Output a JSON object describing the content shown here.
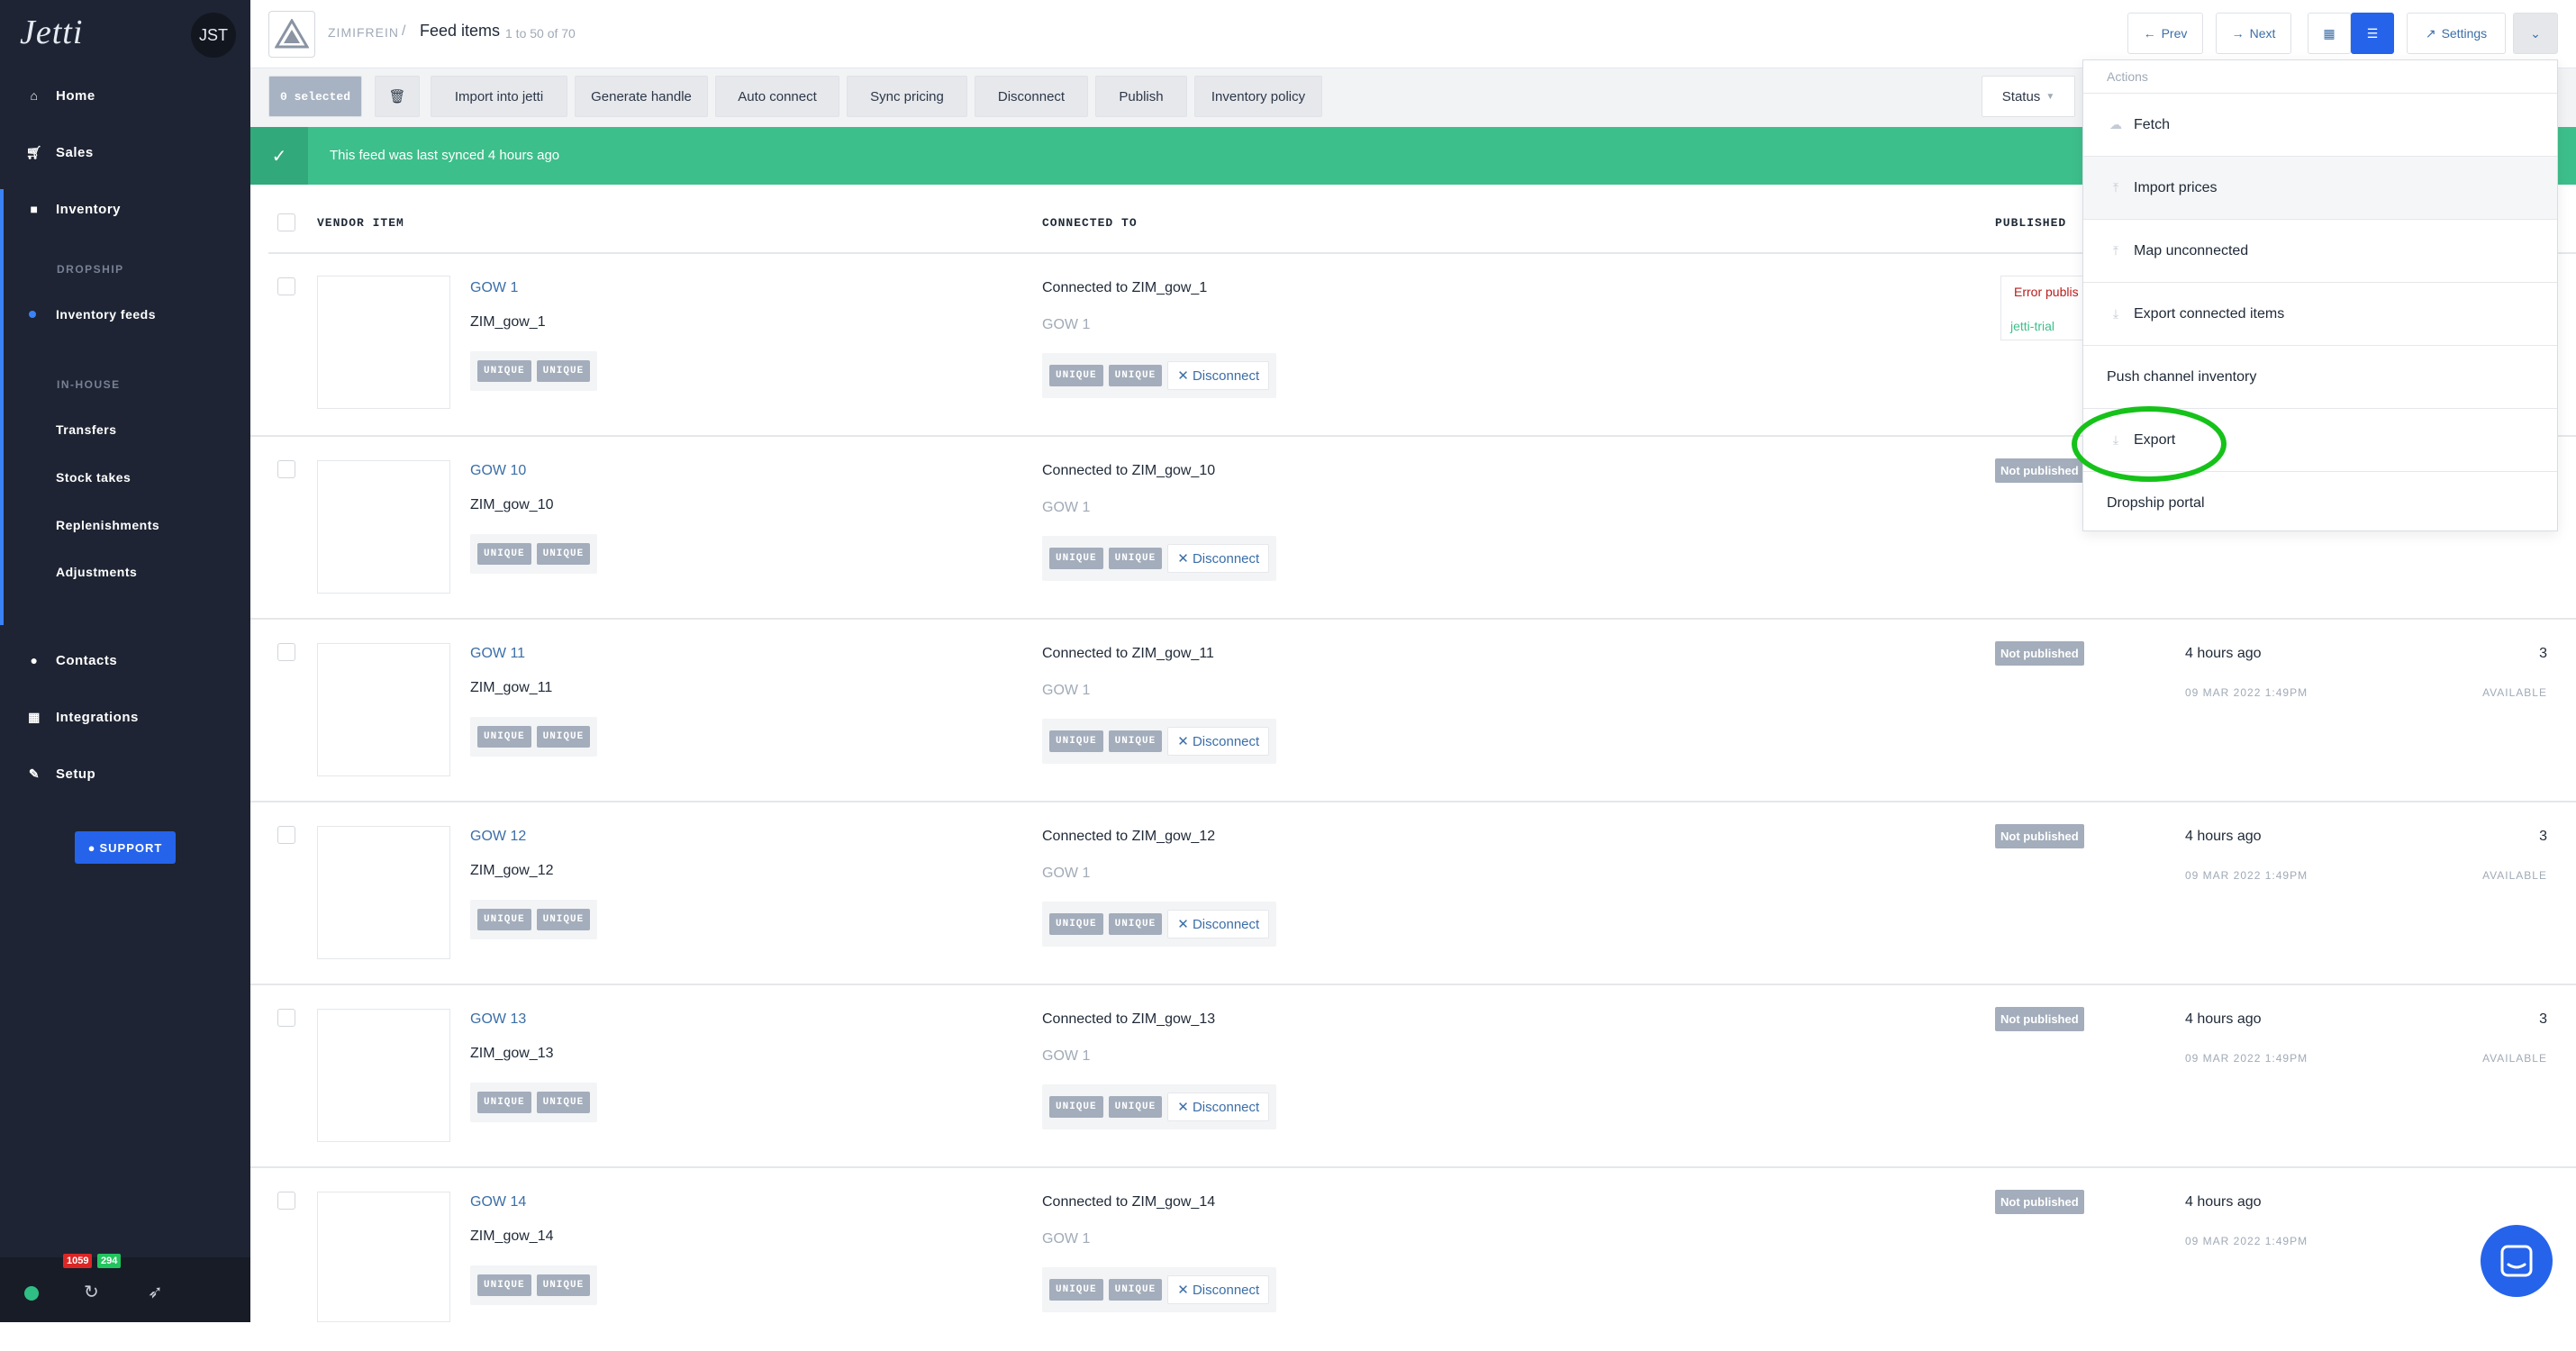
{
  "sidebar": {
    "logo": "Jetti",
    "avatar": "JST",
    "nav": {
      "home": "Home",
      "sales": "Sales",
      "inventory": "Inventory",
      "contacts": "Contacts",
      "integrations": "Integrations",
      "setup": "Setup"
    },
    "dropship_label": "DROPSHIP",
    "inventory_feeds": "Inventory feeds",
    "inhouse_label": "IN-HOUSE",
    "inhouse_items": [
      "Transfers",
      "Stock takes",
      "Replenishments",
      "Adjustments"
    ],
    "support": "SUPPORT",
    "badge_red": "1059",
    "badge_green": "294"
  },
  "header": {
    "breadcrumb": "ZIMIFREIN",
    "separator": "/",
    "title": "Feed items",
    "range": "1 to 50 of 70",
    "prev": "Prev",
    "next": "Next",
    "settings": "Settings"
  },
  "toolbar": {
    "selected": "0 selected",
    "buttons": [
      "Import into jetti",
      "Generate handle",
      "Auto connect",
      "Sync pricing",
      "Disconnect",
      "Publish",
      "Inventory policy"
    ],
    "status": "Status"
  },
  "sync_message": "This feed was last synced 4 hours ago",
  "table": {
    "headers": {
      "vendor_item": "VENDOR ITEM",
      "connected_to": "CONNECTED TO",
      "published": "PUBLISHED"
    },
    "tag": "UNIQUE",
    "disconnect": "Disconnect",
    "rows": [
      {
        "name": "GOW 1",
        "sku": "ZIM_gow_1",
        "connected": "Connected to ZIM_gow_1",
        "sub": "GOW 1",
        "status": "Error publis",
        "status_extra": "jetti-trial",
        "time": "",
        "date": "",
        "qty": "",
        "avail": ""
      },
      {
        "name": "GOW 10",
        "sku": "ZIM_gow_10",
        "connected": "Connected to ZIM_gow_10",
        "sub": "GOW 1",
        "status": "Not published",
        "time": "",
        "date": "",
        "qty": "",
        "avail": ""
      },
      {
        "name": "GOW 11",
        "sku": "ZIM_gow_11",
        "connected": "Connected to ZIM_gow_11",
        "sub": "GOW 1",
        "status": "Not published",
        "time": "4 hours ago",
        "date": "09 MAR 2022 1:49PM",
        "qty": "3",
        "avail": "AVAILABLE"
      },
      {
        "name": "GOW 12",
        "sku": "ZIM_gow_12",
        "connected": "Connected to ZIM_gow_12",
        "sub": "GOW 1",
        "status": "Not published",
        "time": "4 hours ago",
        "date": "09 MAR 2022 1:49PM",
        "qty": "3",
        "avail": "AVAILABLE"
      },
      {
        "name": "GOW 13",
        "sku": "ZIM_gow_13",
        "connected": "Connected to ZIM_gow_13",
        "sub": "GOW 1",
        "status": "Not published",
        "time": "4 hours ago",
        "date": "09 MAR 2022 1:49PM",
        "qty": "3",
        "avail": "AVAILABLE"
      },
      {
        "name": "GOW 14",
        "sku": "ZIM_gow_14",
        "connected": "Connected to ZIM_gow_14",
        "sub": "GOW 1",
        "status": "Not published",
        "time": "4 hours ago",
        "date": "09 MAR 2022 1:49PM",
        "qty": "",
        "avail": ""
      }
    ]
  },
  "actions_menu": {
    "title": "Actions",
    "items": [
      "Fetch",
      "Import prices",
      "Map unconnected",
      "Export connected items",
      "Push channel inventory",
      "Export",
      "Dropship portal"
    ]
  }
}
